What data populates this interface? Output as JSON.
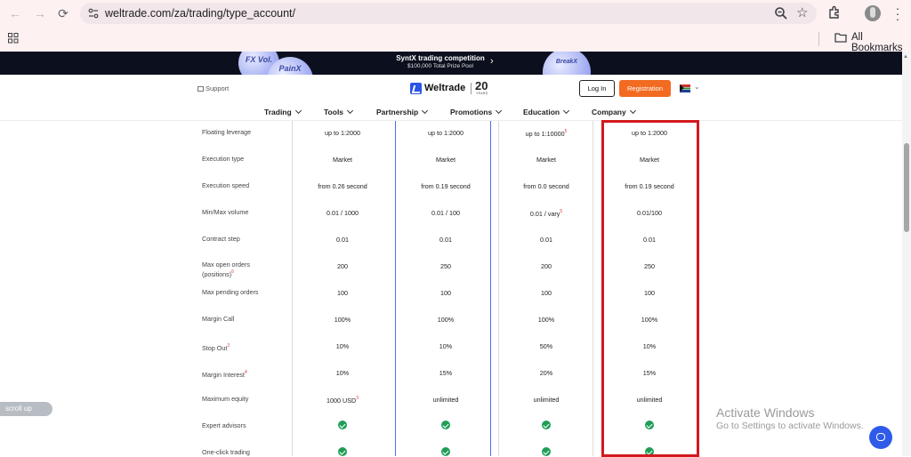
{
  "browser": {
    "url": "weltrade.com/za/trading/type_account/",
    "bookmarks_label": "All Bookmarks"
  },
  "promo": {
    "title": "SyntX trading competition",
    "subtitle": "$100,000 Total Prize Pool",
    "coin_labels": [
      "FX Vol.",
      "PainX",
      "BreakX"
    ]
  },
  "header": {
    "support": "Support",
    "logo_name": "Weltrade",
    "logo_badge": "20",
    "logo_badge_sub": "YEARS",
    "login": "Log In",
    "registration": "Registration",
    "nav": [
      "Trading",
      "Tools",
      "Partnership",
      "Promotions",
      "Education",
      "Company"
    ]
  },
  "table": {
    "rows": [
      {
        "label": "Floating leverage",
        "c1": "up to 1:2000",
        "c2": "up to 1:2000",
        "c3": "up to 1:10000",
        "c3_sup": "5",
        "c4": "up to 1:2000"
      },
      {
        "label": "Execution type",
        "c1": "Market",
        "c2": "Market",
        "c3": "Market",
        "c4": "Market"
      },
      {
        "label": "Execution speed",
        "c1": "from 0.26 second",
        "c2": "from 0.19 second",
        "c3": "from 0.0 second",
        "c4": "from 0.19 second"
      },
      {
        "label": "Min/Max volume",
        "c1": "0.01 / 1000",
        "c2": "0.01 / 100",
        "c3": "0.01 / vary",
        "c3_sup": "5",
        "c4": "0.01/100"
      },
      {
        "label": "Contract step",
        "c1": "0.01",
        "c2": "0.01",
        "c3": "0.01",
        "c4": "0.01"
      },
      {
        "label": "Max open orders (positions)",
        "label_sup": "6",
        "c1": "200",
        "c2": "250",
        "c3": "200",
        "c4": "250"
      },
      {
        "label": "Max pending orders",
        "c1": "100",
        "c2": "100",
        "c3": "100",
        "c4": "100"
      },
      {
        "label": "Margin Call",
        "c1": "100%",
        "c2": "100%",
        "c3": "100%",
        "c4": "100%"
      },
      {
        "label": "Stop Out",
        "label_sup": "3",
        "c1": "10%",
        "c2": "10%",
        "c3": "50%",
        "c4": "10%"
      },
      {
        "label": "Margin Interest",
        "label_sup": "4",
        "c1": "10%",
        "c2": "15%",
        "c3": "20%",
        "c4": "15%"
      },
      {
        "label": "Maximum equity",
        "c1": "1000 USD",
        "c1_sup": "3",
        "c2": "unlimited",
        "c3": "unlimited",
        "c4": "unlimited"
      },
      {
        "label": "Expert advisors",
        "c1_check": true,
        "c2_check": true,
        "c3_check": true,
        "c4_check": true
      },
      {
        "label": "One-click trading",
        "c1_check": true,
        "c2_check": true,
        "c3_check": true,
        "c4_check": true
      }
    ]
  },
  "overlay": {
    "scroll_up": "scroll up",
    "activate_title": "Activate Windows",
    "activate_sub": "Go to Settings to activate Windows."
  },
  "colors": {
    "brand_blue": "#2b55e6",
    "registration_orange": "#f26b21",
    "highlight_red": "#d3181e",
    "check_green": "#1e9e57"
  }
}
